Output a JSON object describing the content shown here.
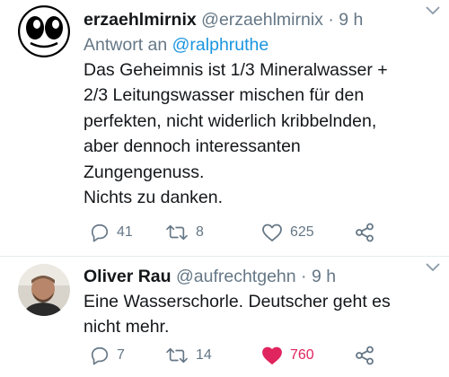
{
  "tweets": [
    {
      "display_name": "erzaehlmirnix",
      "handle": "@erzaehlmirnix",
      "separator": "·",
      "time": "9 h",
      "reply_prefix": "Antwort an",
      "reply_to": "@ralphruthe",
      "text": "Das Geheimnis ist 1/3 Mineralwasser +\n2/3 Leitungswasser mischen für den\nperfekten, nicht widerlich kribbelnden,\naber dennoch interessanten\nZungengenuss.\nNichts zu danken.",
      "replies": "41",
      "retweets": "8",
      "likes": "625",
      "liked": false
    },
    {
      "display_name": "Oliver Rau",
      "handle": "@aufrechtgehn",
      "separator": "·",
      "time": "9 h",
      "text": "Eine Wasserschorle. Deutscher geht es\nnicht mehr.",
      "replies": "7",
      "retweets": "14",
      "likes": "760",
      "liked": true
    }
  ],
  "icons": {
    "reply": "reply-icon",
    "retweet": "retweet-icon",
    "like": "heart-icon",
    "share": "share-icon",
    "menu": "chevron-down-icon"
  },
  "colors": {
    "link": "#1b95e0",
    "secondary": "#657786",
    "liked": "#e0245e",
    "divider": "#e6ecf0"
  }
}
